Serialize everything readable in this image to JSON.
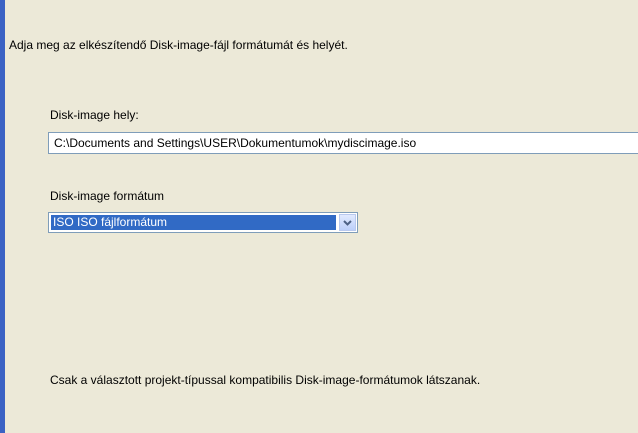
{
  "instruction": "Adja meg az elkészítendő Disk-image-fájl formátumát és helyét.",
  "location": {
    "label": "Disk-image hely:",
    "value": "C:\\Documents and Settings\\USER\\Dokumentumok\\mydiscimage.iso"
  },
  "format": {
    "label": "Disk-image formátum",
    "selected": "ISO ISO fájlformátum",
    "dropdown_icon": "chevron-down-icon"
  },
  "note": "Csak a választott projekt-típussal kompatibilis Disk-image-formátumok látszanak.",
  "colors": {
    "background": "#ece9d8",
    "accent_bar": "#3b62c4",
    "selection": "#316ac5"
  }
}
